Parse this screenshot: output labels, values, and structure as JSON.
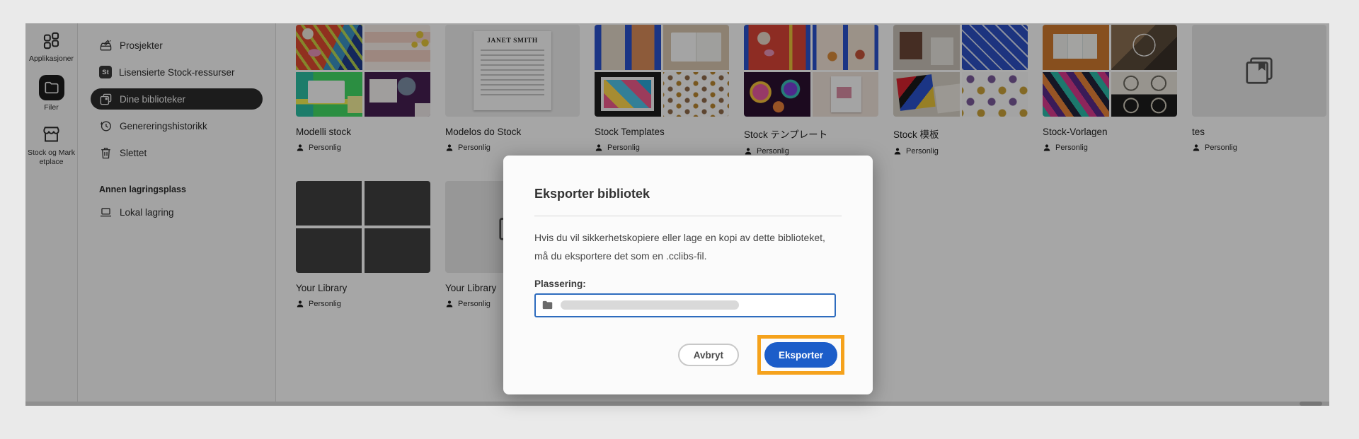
{
  "app": {
    "rail": {
      "items": [
        {
          "label": "Applikasjoner",
          "icon": "apps-grid-icon",
          "active": false
        },
        {
          "label": "Filer",
          "icon": "folder-icon",
          "active": true
        },
        {
          "label": "Stock og Marketplace",
          "icon": "storefront-icon",
          "active": false
        }
      ]
    },
    "sidebar": {
      "items": [
        {
          "label": "Prosjekter",
          "icon": "projects-icon"
        },
        {
          "label": "Lisensierte Stock-ressurser",
          "icon": "stock-badge-icon"
        },
        {
          "label": "Dine biblioteker",
          "icon": "libraries-icon",
          "active": true
        },
        {
          "label": "Genereringshistorikk",
          "icon": "history-icon"
        },
        {
          "label": "Slettet",
          "icon": "trash-icon"
        }
      ],
      "st_badge": "St",
      "section_header": "Annen lagringsplass",
      "local_item": {
        "label": "Lokal lagring",
        "icon": "laptop-icon"
      }
    },
    "libraries": [
      {
        "name": "Modelli stock",
        "access": "Personlig",
        "thumb": "collage"
      },
      {
        "name": "Modelos do Stock",
        "access": "Personlig",
        "thumb": "resume-preview",
        "preview_text": "JANET SMITH"
      },
      {
        "name": "Stock Templates",
        "access": "Personlig",
        "thumb": "collage"
      },
      {
        "name": "Stock テンプレート",
        "access": "Personlig",
        "thumb": "collage"
      },
      {
        "name": "Stock 模板",
        "access": "Personlig",
        "thumb": "collage"
      },
      {
        "name": "Stock-Vorlagen",
        "access": "Personlig",
        "thumb": "collage"
      },
      {
        "name": "tes",
        "access": "Personlig",
        "thumb": "empty-placeholder"
      },
      {
        "name": "Your Library",
        "access": "Personlig",
        "thumb": "dark-grid"
      },
      {
        "name": "Your Library",
        "access": "Personlig",
        "thumb": "empty-placeholder"
      }
    ]
  },
  "dialog": {
    "title": "Eksporter bibliotek",
    "body": "Hvis du vil sikkerhetskopiere eller lage en kopi av dette biblioteket, må du eksportere det som en .cclibs-fil.",
    "location_label": "Plassering:",
    "location_value": "",
    "cancel_label": "Avbryt",
    "confirm_label": "Eksporter"
  },
  "colors": {
    "primary_button": "#1c5dc9",
    "highlight_box": "#f5a21c",
    "input_focus_border": "#2e6cbe",
    "overlay": "rgba(0,0,0,0.35)",
    "selected_menu_item": "#2c2c2c"
  }
}
